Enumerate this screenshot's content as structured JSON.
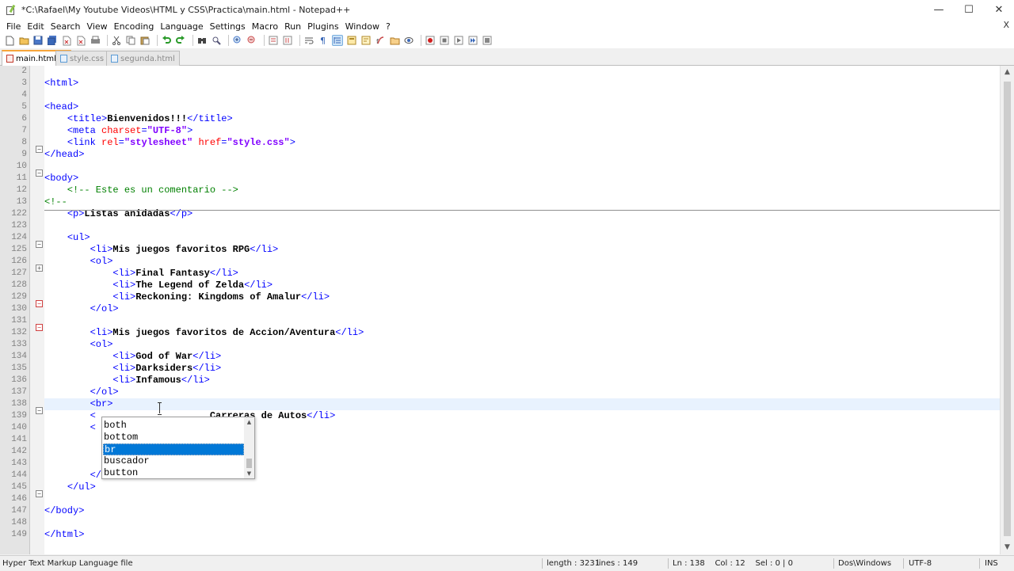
{
  "window": {
    "title": "*C:\\Rafael\\My Youtube Videos\\HTML y CSS\\Practica\\main.html - Notepad++",
    "min_glyph": "—",
    "max_glyph": "☐",
    "close_glyph": "✕"
  },
  "menu": {
    "items": [
      "File",
      "Edit",
      "Search",
      "View",
      "Encoding",
      "Language",
      "Settings",
      "Macro",
      "Run",
      "Plugins",
      "Window",
      "?"
    ],
    "close_glyph": "X"
  },
  "tabs": [
    {
      "label": "main.html",
      "active": true
    },
    {
      "label": "style.css",
      "active": false
    },
    {
      "label": "segunda.html",
      "active": false
    }
  ],
  "editor": {
    "current_line": "138",
    "lines": [
      {
        "num": "2",
        "parts": []
      },
      {
        "num": "3",
        "fold": "minus",
        "parts": [
          [
            "tag",
            "<html>"
          ]
        ]
      },
      {
        "num": "4",
        "parts": []
      },
      {
        "num": "5",
        "fold": "minus",
        "parts": [
          [
            "tag",
            "<head>"
          ]
        ]
      },
      {
        "num": "6",
        "parts": [
          [
            "txt",
            "    "
          ],
          [
            "tag",
            "<title>"
          ],
          [
            "txt",
            "Bienvenidos!!!"
          ],
          [
            "tag",
            "</title>"
          ]
        ]
      },
      {
        "num": "7",
        "parts": [
          [
            "txt",
            "    "
          ],
          [
            "tag",
            "<meta "
          ],
          [
            "attr",
            "charset"
          ],
          [
            "tag",
            "="
          ],
          [
            "val",
            "\"UTF-8\""
          ],
          [
            "tag",
            ">"
          ]
        ]
      },
      {
        "num": "8",
        "parts": [
          [
            "txt",
            "    "
          ],
          [
            "tag",
            "<link "
          ],
          [
            "attr",
            "rel"
          ],
          [
            "tag",
            "="
          ],
          [
            "val",
            "\"stylesheet\""
          ],
          [
            "tag",
            " "
          ],
          [
            "attr",
            "href"
          ],
          [
            "tag",
            "="
          ],
          [
            "val",
            "\"style.css\""
          ],
          [
            "tag",
            ">"
          ]
        ]
      },
      {
        "num": "9",
        "parts": [
          [
            "tag",
            "</head>"
          ]
        ]
      },
      {
        "num": "10",
        "parts": []
      },
      {
        "num": "11",
        "fold": "minus",
        "parts": [
          [
            "tag",
            "<body>"
          ]
        ]
      },
      {
        "num": "12",
        "parts": [
          [
            "com",
            "    <!-- Este es un comentario -->"
          ]
        ]
      },
      {
        "num": "13",
        "fold": "plus",
        "parts": [
          [
            "com",
            "<!--"
          ]
        ]
      },
      {
        "num": "122",
        "parts": [
          [
            "txt",
            "    "
          ],
          [
            "tag",
            "<p>"
          ],
          [
            "txt",
            "Listas anidadas"
          ],
          [
            "tag",
            "</p>"
          ]
        ]
      },
      {
        "num": "123",
        "parts": []
      },
      {
        "num": "124",
        "fold": "minus-red",
        "parts": [
          [
            "txt",
            "    "
          ],
          [
            "tag",
            "<ul>"
          ]
        ]
      },
      {
        "num": "125",
        "parts": [
          [
            "txt",
            "        "
          ],
          [
            "tag",
            "<li>"
          ],
          [
            "txt",
            "Mis juegos favoritos RPG"
          ],
          [
            "tag",
            "</li>"
          ]
        ]
      },
      {
        "num": "126",
        "fold": "minus-red",
        "parts": [
          [
            "txt",
            "        "
          ],
          [
            "tag",
            "<ol>"
          ]
        ]
      },
      {
        "num": "127",
        "parts": [
          [
            "txt",
            "            "
          ],
          [
            "tag",
            "<li>"
          ],
          [
            "txt",
            "Final Fantasy"
          ],
          [
            "tag",
            "</li>"
          ]
        ]
      },
      {
        "num": "128",
        "parts": [
          [
            "txt",
            "            "
          ],
          [
            "tag",
            "<li>"
          ],
          [
            "txt",
            "The Legend of Zelda"
          ],
          [
            "tag",
            "</li>"
          ]
        ]
      },
      {
        "num": "129",
        "parts": [
          [
            "txt",
            "            "
          ],
          [
            "tag",
            "<li>"
          ],
          [
            "txt",
            "Reckoning: Kingdoms of Amalur"
          ],
          [
            "tag",
            "</li>"
          ]
        ]
      },
      {
        "num": "130",
        "parts": [
          [
            "txt",
            "        "
          ],
          [
            "tag",
            "</ol>"
          ]
        ]
      },
      {
        "num": "131",
        "parts": []
      },
      {
        "num": "132",
        "parts": [
          [
            "txt",
            "        "
          ],
          [
            "tag",
            "<li>"
          ],
          [
            "txt",
            "Mis juegos favoritos de Accion/Aventura"
          ],
          [
            "tag",
            "</li>"
          ]
        ]
      },
      {
        "num": "133",
        "fold": "minus",
        "parts": [
          [
            "txt",
            "        "
          ],
          [
            "tag",
            "<ol>"
          ]
        ]
      },
      {
        "num": "134",
        "parts": [
          [
            "txt",
            "            "
          ],
          [
            "tag",
            "<li>"
          ],
          [
            "txt",
            "God of War"
          ],
          [
            "tag",
            "</li>"
          ]
        ]
      },
      {
        "num": "135",
        "parts": [
          [
            "txt",
            "            "
          ],
          [
            "tag",
            "<li>"
          ],
          [
            "txt",
            "Darksiders"
          ],
          [
            "tag",
            "</li>"
          ]
        ]
      },
      {
        "num": "136",
        "parts": [
          [
            "txt",
            "            "
          ],
          [
            "tag",
            "<li>"
          ],
          [
            "txt",
            "Infamous"
          ],
          [
            "tag",
            "</li>"
          ]
        ]
      },
      {
        "num": "137",
        "parts": [
          [
            "txt",
            "        "
          ],
          [
            "tag",
            "</ol>"
          ]
        ]
      },
      {
        "num": "138",
        "parts": [
          [
            "txt",
            "        "
          ],
          [
            "tag",
            "<br>"
          ]
        ]
      },
      {
        "num": "139",
        "parts": [
          [
            "txt",
            "        "
          ],
          [
            "tag",
            "<"
          ],
          [
            "txt",
            "                    Carreras de Autos"
          ],
          [
            "tag",
            "</li>"
          ]
        ]
      },
      {
        "num": "140",
        "fold": "minus",
        "parts": [
          [
            "txt",
            "        "
          ],
          [
            "tag",
            "<"
          ]
        ]
      },
      {
        "num": "141",
        "parts": []
      },
      {
        "num": "142",
        "parts": [
          [
            "txt",
            "                                "
          ],
          [
            "tag",
            "i>"
          ]
        ]
      },
      {
        "num": "143",
        "parts": []
      },
      {
        "num": "144",
        "parts": [
          [
            "txt",
            "        "
          ],
          [
            "tag",
            "</ol>"
          ]
        ]
      },
      {
        "num": "145",
        "parts": [
          [
            "txt",
            "    "
          ],
          [
            "tag",
            "</ul>"
          ]
        ]
      },
      {
        "num": "146",
        "parts": []
      },
      {
        "num": "147",
        "parts": [
          [
            "tag",
            "</body>"
          ]
        ]
      },
      {
        "num": "148",
        "parts": []
      },
      {
        "num": "149",
        "parts": [
          [
            "tag",
            "</html>"
          ]
        ]
      }
    ]
  },
  "autocomplete": {
    "items": [
      "both",
      "bottom",
      "br",
      "buscador",
      "button"
    ],
    "selected": "br"
  },
  "statusbar": {
    "file_type": "Hyper Text Markup Language file",
    "length": "length : 3231",
    "lines": "lines : 149",
    "position": "Ln : 138    Col : 12    Sel : 0 | 0",
    "eol": "Dos\\Windows",
    "encoding": "UTF-8",
    "mode": "INS"
  },
  "colors": {
    "tag": "#0000ff",
    "attr": "#ff0000",
    "value": "#8000ff",
    "comment": "#008000",
    "current_line": "#e8f2fe",
    "selection": "#0078d7"
  }
}
